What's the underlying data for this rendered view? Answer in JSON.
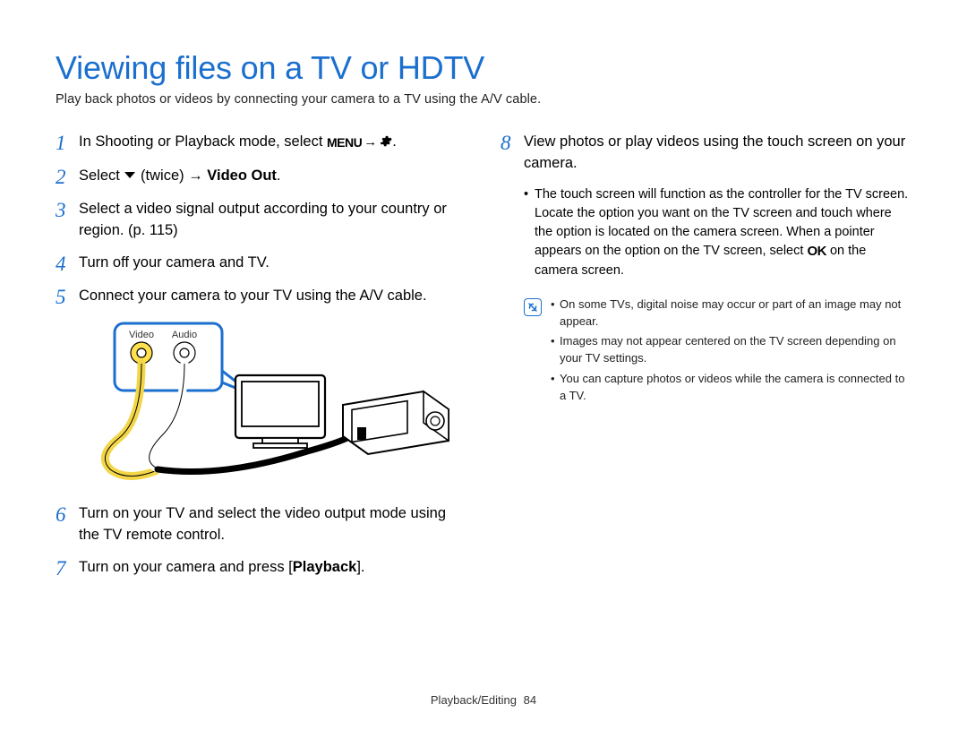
{
  "header": {
    "title": "Viewing files on a TV or HDTV",
    "subtitle": "Play back photos or videos by connecting your camera to a TV using the A/V cable."
  },
  "left": {
    "steps": {
      "s1": {
        "num": "1",
        "pre": "In Shooting or Playback mode, select ",
        "menu": "MENU",
        "arrow": " → ",
        "gear": true,
        "post": "."
      },
      "s2": {
        "num": "2",
        "pre": "Select ",
        "mid": " (twice) → ",
        "bold": "Video Out",
        "post": "."
      },
      "s3": {
        "num": "3",
        "text": "Select a video signal output according to your country or region. (p. 115)"
      },
      "s4": {
        "num": "4",
        "text": "Turn off your camera and TV."
      },
      "s5": {
        "num": "5",
        "text": "Connect your camera to your TV using the A/V cable."
      },
      "s6": {
        "num": "6",
        "text": "Turn on your TV and select the video output mode using the TV remote control."
      },
      "s7": {
        "num": "7",
        "pre": "Turn on your camera and press [",
        "bold": "Playback",
        "post": "]."
      }
    },
    "diagram": {
      "video_label": "Video",
      "audio_label": "Audio"
    }
  },
  "right": {
    "step8": {
      "num": "8",
      "text": "View photos or play videos using the touch screen on your camera."
    },
    "bullet8": {
      "pre": "The touch screen will function as the controller for the TV screen. Locate the option you want on the TV screen and touch where the option is located on the camera screen. When a pointer appears on the option on the TV screen, select ",
      "ok": "OK",
      "post": " on the camera screen."
    },
    "notes": {
      "n1": "On some TVs, digital noise may occur or part of an image may not appear.",
      "n2": "Images may not appear centered on the TV screen depending on your TV settings.",
      "n3": "You can capture photos or videos while the camera is connected to a TV."
    }
  },
  "footer": {
    "section": "Playback/Editing",
    "page": "84"
  }
}
